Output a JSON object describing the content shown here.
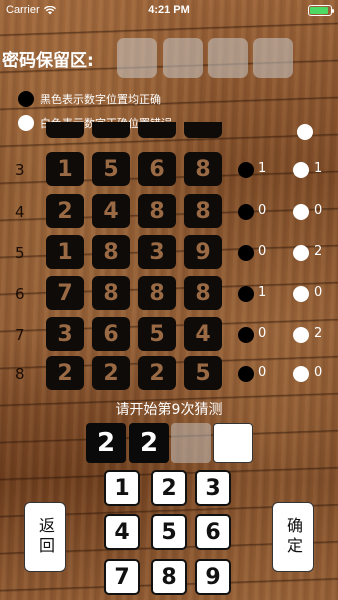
{
  "status": {
    "carrier": "Carrier",
    "time": "4:21 PM",
    "battery_level": 0.9
  },
  "secret": {
    "label": "密码保留区:"
  },
  "legend": {
    "black": {
      "text": "黑色表示数字位置均正确",
      "color": "#000000"
    },
    "white": {
      "text": "白色表示数字正确位置错误",
      "color": "#ffffff"
    }
  },
  "rows": [
    {
      "n": "3",
      "digits": [
        "1",
        "5",
        "6",
        "8"
      ],
      "black": "1",
      "white": "1"
    },
    {
      "n": "4",
      "digits": [
        "2",
        "4",
        "8",
        "8"
      ],
      "black": "0",
      "white": "0"
    },
    {
      "n": "5",
      "digits": [
        "1",
        "8",
        "3",
        "9"
      ],
      "black": "0",
      "white": "2"
    },
    {
      "n": "6",
      "digits": [
        "7",
        "8",
        "8",
        "8"
      ],
      "black": "1",
      "white": "0"
    },
    {
      "n": "7",
      "digits": [
        "3",
        "6",
        "5",
        "4"
      ],
      "black": "0",
      "white": "2"
    },
    {
      "n": "8",
      "digits": [
        "2",
        "2",
        "2",
        "5"
      ],
      "black": "0",
      "white": "0"
    }
  ],
  "prompt": "请开始第9次猜测",
  "input": [
    "2",
    "2",
    "",
    ""
  ],
  "keypad": [
    "1",
    "2",
    "3",
    "4",
    "5",
    "6",
    "7",
    "8",
    "9"
  ],
  "back_label": "返回",
  "confirm_label": "确定"
}
